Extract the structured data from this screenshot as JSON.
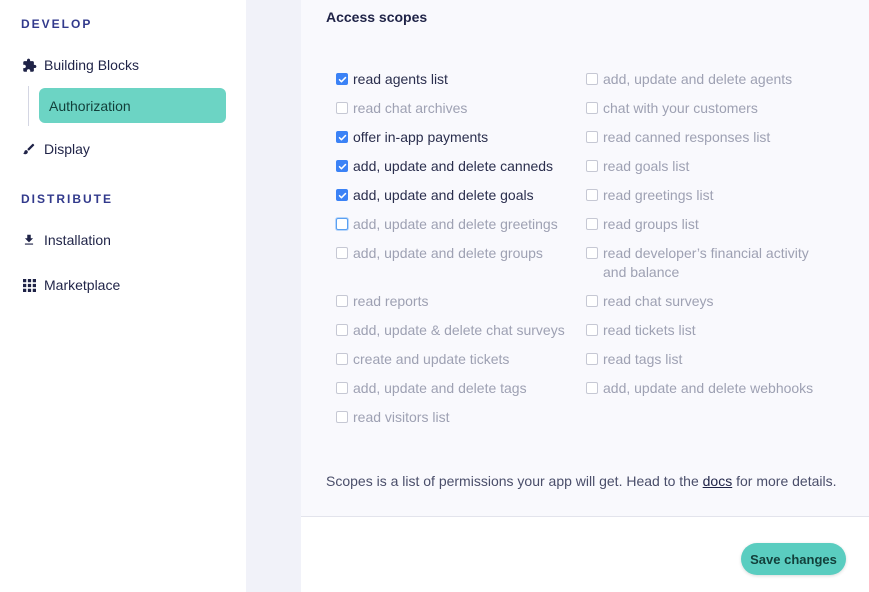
{
  "sidebar": {
    "develop_title": "DEVELOP",
    "building_blocks": "Building Blocks",
    "authorization": "Authorization",
    "display": "Display",
    "distribute_title": "DISTRIBUTE",
    "installation": "Installation",
    "marketplace": "Marketplace"
  },
  "panel": {
    "title": "Access scopes",
    "left_scopes": [
      {
        "label": "read agents list",
        "checked": true
      },
      {
        "label": "read chat archives",
        "checked": false
      },
      {
        "label": "offer in-app payments",
        "checked": true
      },
      {
        "label": "add, update and delete canneds",
        "checked": true
      },
      {
        "label": "add, update and delete goals",
        "checked": true
      },
      {
        "label": "add, update and delete greetings",
        "checked": false
      },
      {
        "label": "add, update and delete groups",
        "checked": false
      },
      {
        "label": "read reports",
        "checked": false
      },
      {
        "label": "add, update & delete chat surveys",
        "checked": false
      },
      {
        "label": "create and update tickets",
        "checked": false
      },
      {
        "label": "add, update and delete tags",
        "checked": false
      },
      {
        "label": "read visitors list",
        "checked": false
      }
    ],
    "right_scopes": [
      {
        "label": "add, update and delete agents",
        "checked": false
      },
      {
        "label": "chat with your customers",
        "checked": false
      },
      {
        "label": "read canned responses list",
        "checked": false
      },
      {
        "label": "read goals list",
        "checked": false
      },
      {
        "label": "read greetings list",
        "checked": false
      },
      {
        "label": "read groups list",
        "checked": false
      },
      {
        "label": "read developer’s financial activity and balance",
        "checked": false
      },
      {
        "label": "read chat surveys",
        "checked": false
      },
      {
        "label": "read tickets list",
        "checked": false
      },
      {
        "label": "read tags list",
        "checked": false
      },
      {
        "label": "add, update and delete webhooks",
        "checked": false
      }
    ],
    "note_before": "Scopes is a list of permissions your app will get. Head to the ",
    "note_link": "docs",
    "note_after": " for more details."
  },
  "actions": {
    "save_label": "Save changes"
  },
  "colors": {
    "accent": "#5acdc0",
    "active_nav": "#6cd4c4",
    "checkbox_checked": "#3b82f6",
    "section_title": "#323a8c"
  }
}
